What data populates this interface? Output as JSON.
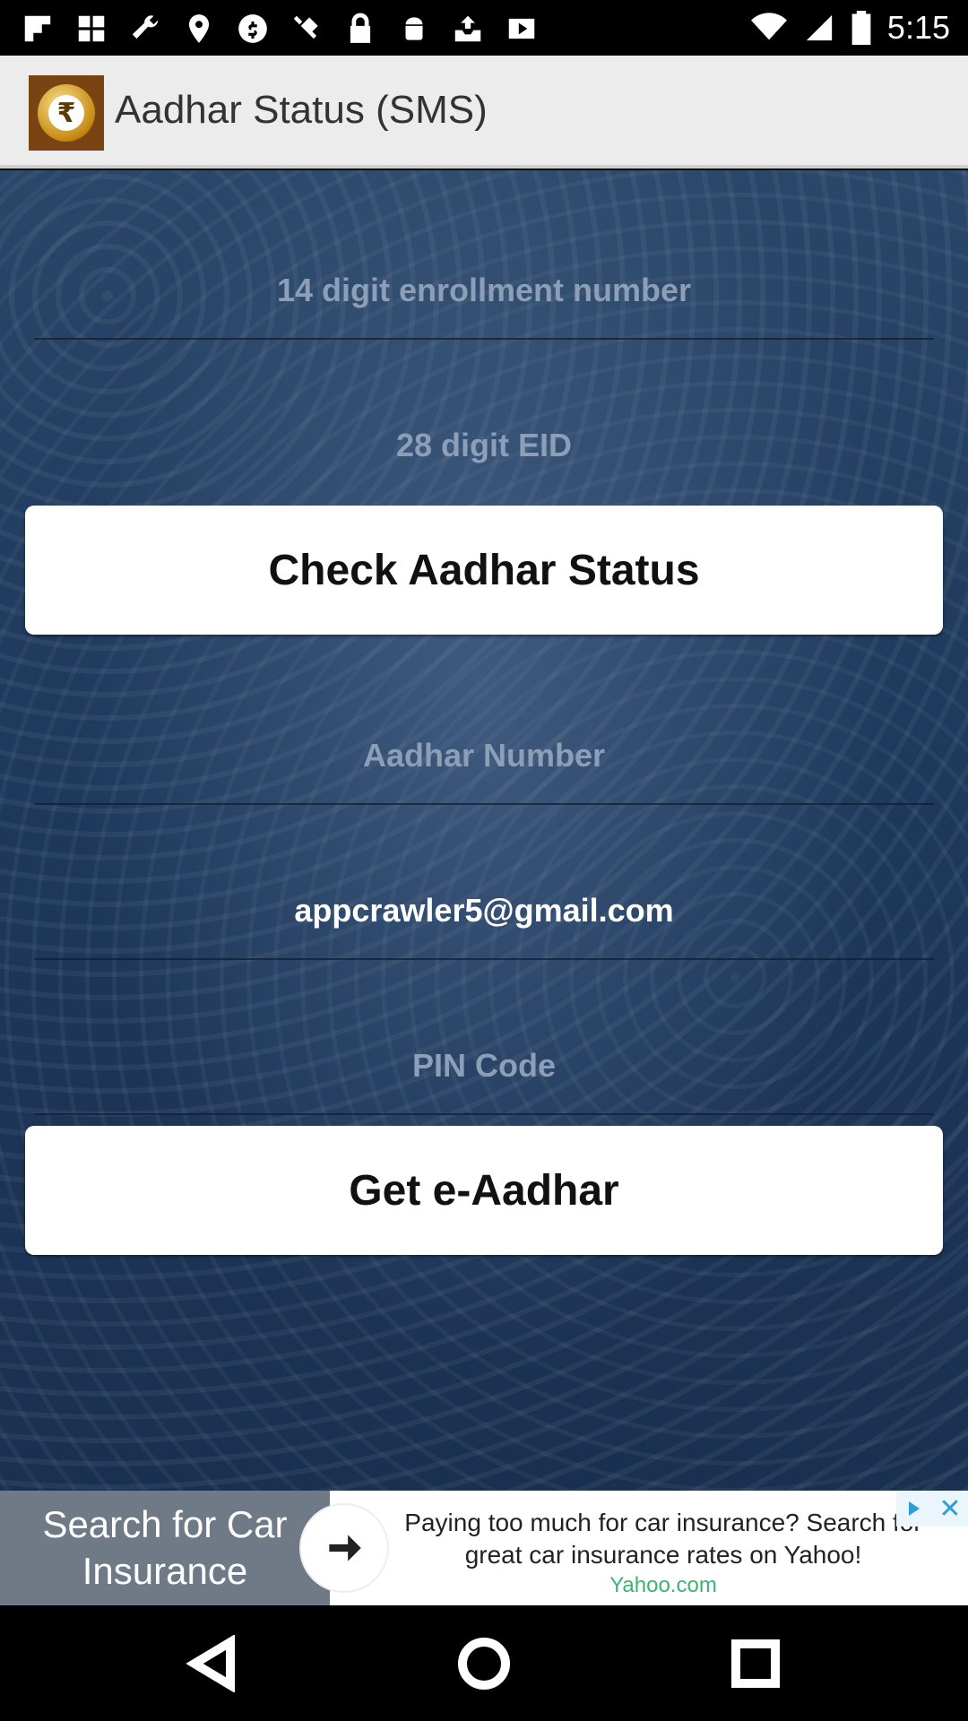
{
  "status_bar": {
    "time": "5:15",
    "icons": [
      "flipboard-icon",
      "grid-icon",
      "wrench-icon",
      "fake-gps-icon",
      "circle-dollar-icon",
      "satellite-icon",
      "lock-icon",
      "android-icon",
      "inbox-tray-icon",
      "play-store-icon"
    ],
    "right_icons": [
      "wifi-icon",
      "signal-icon",
      "battery-icon"
    ]
  },
  "app_bar": {
    "title": "Aadhar Status (SMS)",
    "icon": "rupee-coin-icon"
  },
  "form": {
    "enrollment_placeholder": "14 digit enrollment number",
    "eid_placeholder": "28 digit EID",
    "check_button_label": "Check Aadhar Status",
    "aadhar_number_placeholder": "Aadhar Number",
    "email_value": "appcrawler5@gmail.com",
    "pin_placeholder": "PIN Code",
    "get_eaadhar_label": "Get e-Aadhar"
  },
  "ad": {
    "left_text": "Search for Car Insurance",
    "body_text": "Paying too much for car insurance? Search for great car insurance rates on Yahoo!",
    "source": "Yahoo.com",
    "colors": {
      "left_panel": "#6f7a86",
      "source_text": "#3cb371"
    }
  },
  "nav_bar": {
    "buttons": [
      "back-triangle-icon",
      "home-circle-icon",
      "recents-square-icon"
    ]
  },
  "colors": {
    "app_bar_bg": "#ececec",
    "main_bg": "#1f3a5c",
    "placeholder_text": "#8c9fb6",
    "button_bg": "#ffffff"
  }
}
